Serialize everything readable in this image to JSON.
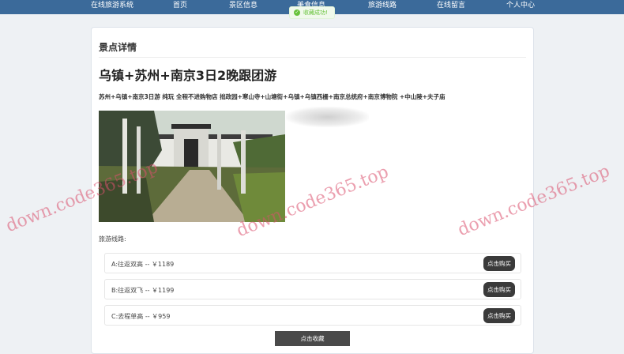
{
  "nav": {
    "items": [
      {
        "label": "在线旅游系统"
      },
      {
        "label": "首页"
      },
      {
        "label": "景区信息"
      },
      {
        "label": "美食信息"
      },
      {
        "label": "旅游线路"
      },
      {
        "label": "在线留言"
      },
      {
        "label": "个人中心"
      }
    ]
  },
  "toast": {
    "text": "收藏成功!"
  },
  "detail": {
    "section_title": "景点详情",
    "title": "乌镇+苏州+南京3日2晚跟团游",
    "description": "苏州+乌镇+南京3日游 纯玩 全程不进购物店 拙政园+寒山寺+山塘街+乌镇+乌镇西栅+南京总统府+南京博物院 +中山陵+夫子庙",
    "routes_label": "旅游线路:",
    "routes": [
      {
        "text": "A:往返双高 -- ￥1189",
        "button": "点击购买"
      },
      {
        "text": "B:往返双飞 -- ￥1199",
        "button": "点击购买"
      },
      {
        "text": "C:去程单高 -- ￥959",
        "button": "点击购买"
      }
    ],
    "favorite_button": "点击收藏"
  },
  "watermarks": [
    "down.code365.top",
    "down.code365.top",
    "down.code365.top"
  ],
  "colors": {
    "nav_bg": "#3b6a9a",
    "button_bg": "#3a3a3a",
    "toast_green": "#67c23a",
    "watermark": "#da506e"
  }
}
